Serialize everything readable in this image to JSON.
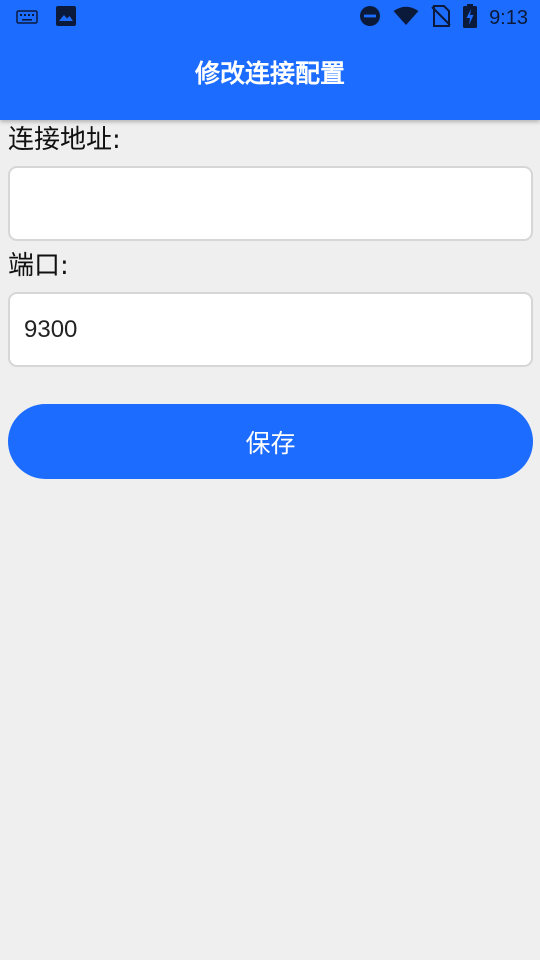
{
  "status_bar": {
    "time": "9:13",
    "icons": [
      "keyboard-icon",
      "image-icon",
      "do-not-disturb-icon",
      "wifi-icon",
      "no-sim-icon",
      "battery-charging-icon"
    ]
  },
  "toolbar": {
    "title": "修改连接配置"
  },
  "form": {
    "address": {
      "label": "连接地址:",
      "value": "",
      "placeholder": ""
    },
    "port": {
      "label": "端口:",
      "value": "9300",
      "placeholder": ""
    },
    "save_label": "保存"
  },
  "colors": {
    "primary": "#1c6cff",
    "background": "#efefef",
    "input_border": "#d6d6d6"
  }
}
